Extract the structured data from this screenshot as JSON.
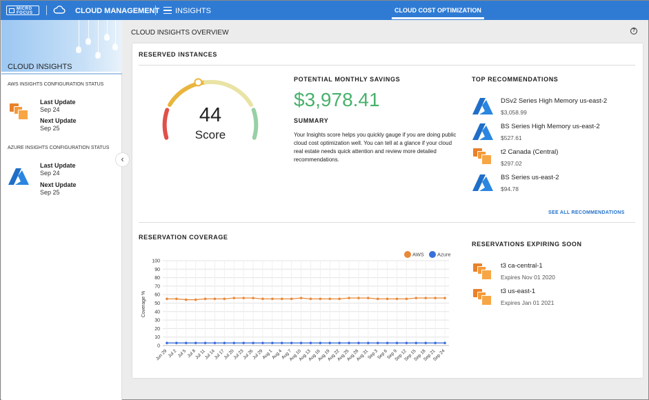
{
  "header": {
    "logo_text": "MICRO FOCUS",
    "app_name": "CLOUD MANAGEMENT",
    "section": "INSIGHTS",
    "active_tab": "CLOUD COST OPTIMIZATION",
    "brand_color": "#2f7bd4"
  },
  "sidebar": {
    "title": "CLOUD INSIGHTS",
    "aws": {
      "status_title": "AWS INSIGHTS CONFIGURATION STATUS",
      "last_update_label": "Last Update",
      "last_update": "Sep 24",
      "next_update_label": "Next Update",
      "next_update": "Sep 25",
      "icon": "aws-boxes-icon"
    },
    "azure": {
      "status_title": "AZURE INSIGHTS CONFIGURATION STATUS",
      "last_update_label": "Last Update",
      "last_update": "Sep 24",
      "next_update_label": "Next Update",
      "next_update": "Sep 25",
      "icon": "azure-logo-icon"
    },
    "collapse_icon": "chevron-left-icon"
  },
  "main": {
    "title": "CLOUD INSIGHTS OVERVIEW",
    "help_icon": "question-circle-icon",
    "reserved_instances": {
      "title": "RESERVED INSTANCES",
      "score": "44",
      "score_label": "Score",
      "score_fraction": 0.44,
      "potential_savings_title": "POTENTIAL MONTHLY SAVINGS",
      "potential_savings": "$3,978.41",
      "summary_title": "SUMMARY",
      "summary_text": "Your Insights score helps you quickly gauge if you are doing public cloud cost optimization well. You can tell at a glance if your cloud real estate needs quick attention and review more detailed recommendations.",
      "savings_color": "#48b16b"
    },
    "top_recommendations": {
      "title": "TOP RECOMMENDATIONS",
      "items": [
        {
          "name": "DSv2 Series High Memory us-east-2",
          "price": "$3,058.99",
          "provider": "azure"
        },
        {
          "name": "BS Series High Memory us-east-2",
          "price": "$527.61",
          "provider": "azure"
        },
        {
          "name": "t2 Canada (Central)",
          "price": "$297.02",
          "provider": "aws"
        },
        {
          "name": "BS Series us-east-2",
          "price": "$94.78",
          "provider": "azure"
        }
      ],
      "see_all": "SEE ALL RECOMMENDATIONS"
    },
    "reservation_coverage": {
      "title": "RESERVATION COVERAGE"
    },
    "expiring": {
      "title": "RESERVATIONS EXPIRING SOON",
      "items": [
        {
          "name": "t3 ca-central-1",
          "date": "Expires Nov 01 2020"
        },
        {
          "name": "t3 us-east-1",
          "date": "Expires Jan 01 2021"
        }
      ]
    }
  },
  "chart_data": {
    "type": "line",
    "title": "",
    "xlabel": "",
    "ylabel": "Coverage %",
    "ylim": [
      0,
      100
    ],
    "yticks": [
      0,
      10,
      20,
      30,
      40,
      50,
      60,
      70,
      80,
      90,
      100
    ],
    "grid": true,
    "legend": "top-right",
    "categories": [
      "Jun 29",
      "Jul 2",
      "Jul 5",
      "Jul 8",
      "Jul 11",
      "Jul 14",
      "Jul 17",
      "Jul 20",
      "Jul 23",
      "Jul 26",
      "Jul 29",
      "Aug 1",
      "Aug 4",
      "Aug 7",
      "Aug 10",
      "Aug 13",
      "Aug 16",
      "Aug 19",
      "Aug 22",
      "Aug 25",
      "Aug 28",
      "Aug 31",
      "Sep 3",
      "Sep 6",
      "Sep 9",
      "Sep 12",
      "Sep 15",
      "Sep 18",
      "Sep 21",
      "Sep 24"
    ],
    "series": [
      {
        "name": "AWS",
        "color": "#e8893a",
        "values": [
          55,
          55,
          54,
          54,
          55,
          55,
          55,
          56,
          56,
          56,
          55,
          55,
          55,
          55,
          56,
          55,
          55,
          55,
          55,
          56,
          56,
          56,
          55,
          55,
          55,
          55,
          56,
          56,
          56,
          56
        ]
      },
      {
        "name": "Azure",
        "color": "#3a6fdc",
        "values": [
          3,
          3,
          3,
          3,
          3,
          3,
          3,
          3,
          3,
          3,
          3,
          3,
          3,
          3,
          3,
          3,
          3,
          3,
          3,
          3,
          3,
          3,
          3,
          3,
          3,
          3,
          3,
          3,
          3,
          3
        ]
      }
    ]
  }
}
